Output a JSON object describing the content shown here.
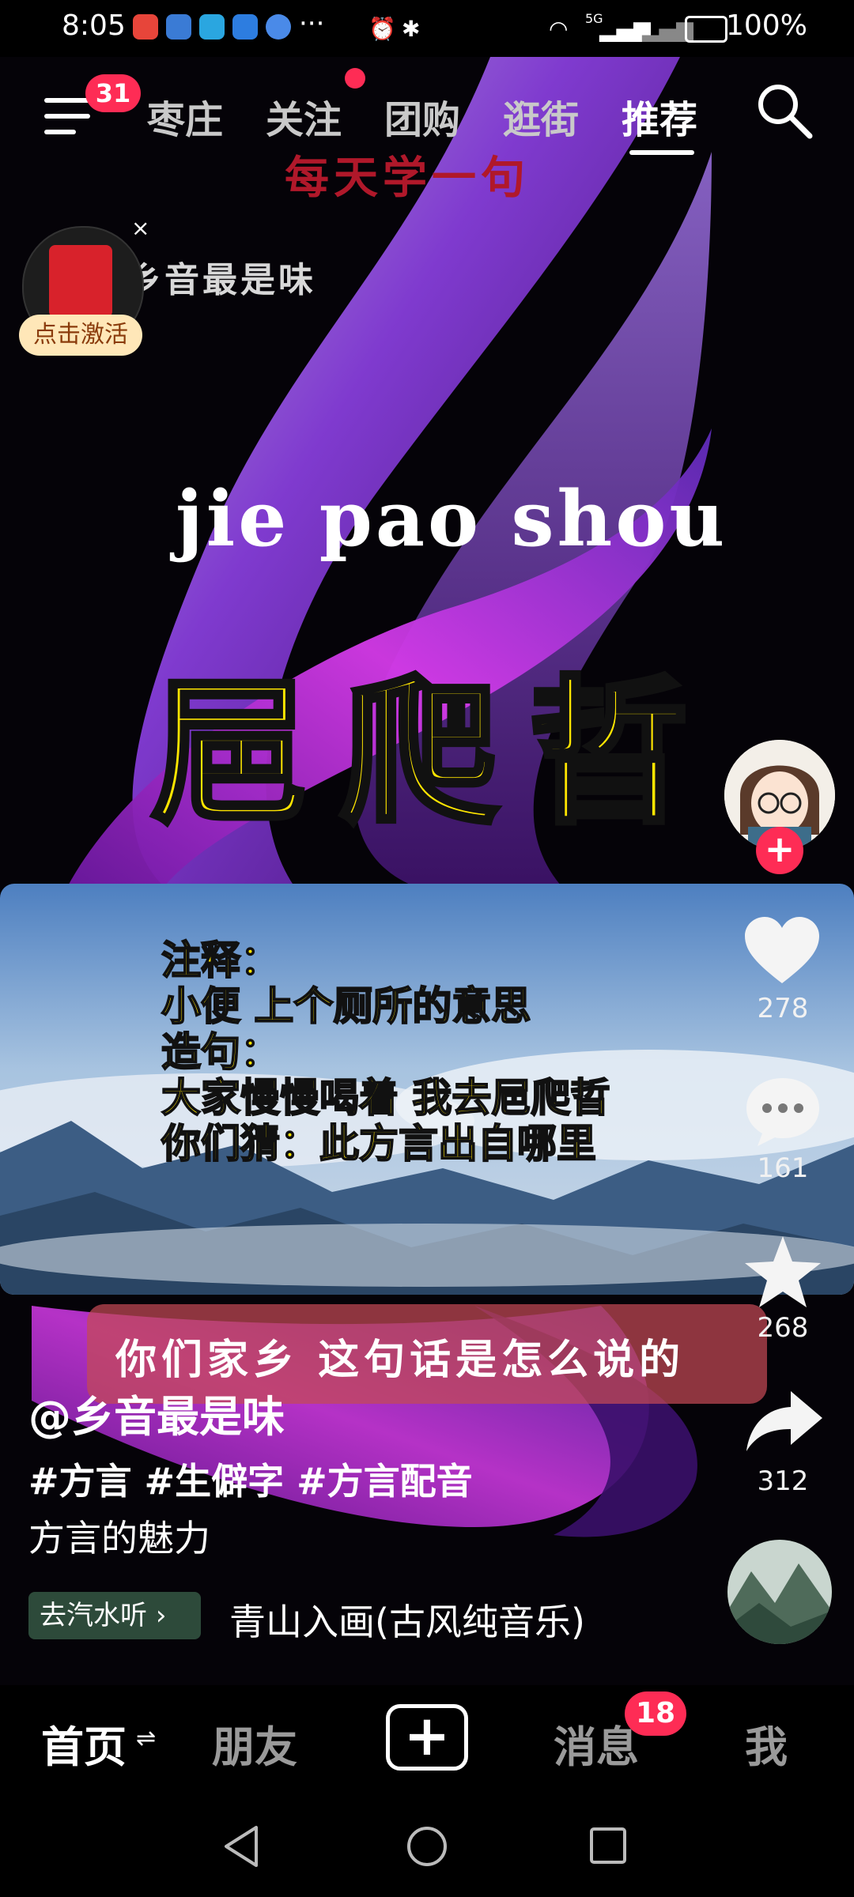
{
  "status_bar": {
    "time": "8:05",
    "more": "···",
    "battery": "100%",
    "network": "5G"
  },
  "top_nav": {
    "menu_badge": "31",
    "tabs": [
      {
        "label": "枣庄"
      },
      {
        "label": "关注"
      },
      {
        "label": "团购"
      },
      {
        "label": "逛街"
      },
      {
        "label": "推荐"
      }
    ],
    "active_tab": "推荐"
  },
  "red_packet": {
    "activate_label": "点击激活",
    "close": "×"
  },
  "video": {
    "daily_line": "每天学一句",
    "watermark": "乡音最是味",
    "pinyin": "jie  pao  shou",
    "hanzi": "㞎爬晢",
    "panel_lines": [
      "注释：",
      "小便 上个厕所的意思",
      "造句：",
      "大家慢慢喝着 我去㞎爬晢",
      "你们猜：此方言出自哪里"
    ],
    "question": "你们家乡 这句话是怎么说的"
  },
  "right_rail": {
    "likes": "278",
    "comments": "161",
    "favorites": "268",
    "shares": "312"
  },
  "caption": {
    "author": "@乡音最是味",
    "hashtags": "#方言 #生僻字 #方言配音",
    "description": "方言的魅力",
    "music_button": "去汽水听",
    "music_title": "青山入画(古风纯音乐)"
  },
  "bottom_nav": {
    "items": [
      {
        "label": "首页"
      },
      {
        "label": "朋友"
      },
      {
        "label": "消息"
      },
      {
        "label": "我"
      }
    ],
    "home_switch": "⇌",
    "add": "+",
    "message_badge": "18"
  },
  "colors": {
    "accent": "#fe2c55",
    "highlight_text": "#ffe600",
    "ribbon": "#9b2fd6"
  },
  "icons": {
    "menu": "menu-icon",
    "search": "search-icon",
    "like": "heart-icon",
    "comment": "comment-icon",
    "favorite": "star-icon",
    "share": "share-icon",
    "back": "back-triangle-icon",
    "home": "home-circle-icon",
    "recents": "recents-square-icon"
  }
}
